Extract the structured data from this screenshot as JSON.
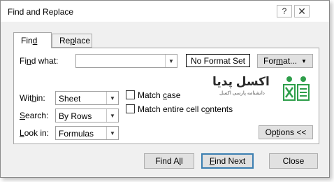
{
  "window": {
    "title": "Find and Replace",
    "help_glyph": "?",
    "close_glyph": "✕"
  },
  "tabs": [
    {
      "label_pre": "Fin",
      "label_u": "d",
      "label_post": "",
      "active": true
    },
    {
      "label_pre": "Re",
      "label_u": "p",
      "label_post": "lace",
      "active": false
    }
  ],
  "find": {
    "label_pre": "Fi",
    "label_u": "n",
    "label_post": "d what:",
    "value": "",
    "no_format_label": "No Format Set",
    "format_pre": "For",
    "format_u": "m",
    "format_post": "at...",
    "dropdown_glyph": "▼"
  },
  "options": {
    "within": {
      "label_pre": "Wit",
      "label_u": "h",
      "label_post": "in:",
      "value": "Sheet"
    },
    "search": {
      "label_pre": "",
      "label_u": "S",
      "label_post": "earch:",
      "value": "By Rows"
    },
    "look_in": {
      "label_pre": "",
      "label_u": "L",
      "label_post": "ook in:",
      "value": "Formulas"
    },
    "match_case": {
      "label_pre": "Match ",
      "label_u": "c",
      "label_post": "ase",
      "checked": false
    },
    "match_entire": {
      "label_pre": "Match entire cell c",
      "label_u": "o",
      "label_post": "ntents",
      "checked": false
    },
    "options_pre": "Op",
    "options_u": "t",
    "options_post": "ions <<"
  },
  "logo": {
    "main": "اکسل پدیا",
    "sub": "دانشنامه پارسی اکسل",
    "colors": {
      "green": "#2e9e4a",
      "text": "#2b2b2b"
    }
  },
  "footer": {
    "find_all_pre": "Find A",
    "find_all_u": "l",
    "find_all_post": "l",
    "find_next_pre": "",
    "find_next_u": "F",
    "find_next_post": "ind Next",
    "close_label": "Close"
  }
}
